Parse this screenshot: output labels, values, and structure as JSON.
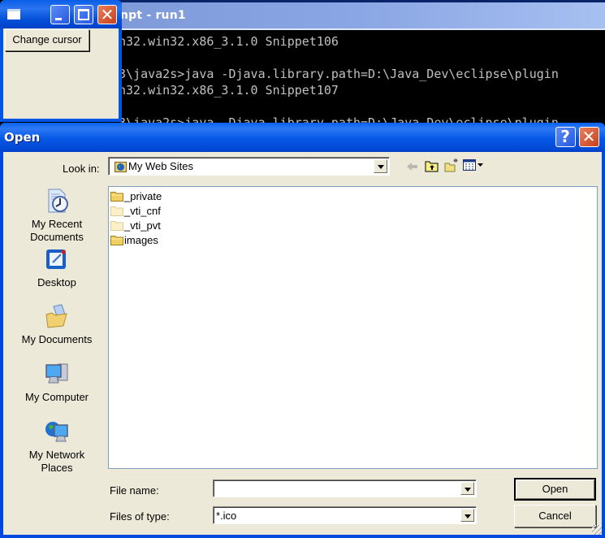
{
  "console": {
    "title": "npt - run1",
    "lines": [
      "n32.win32.x86_3.1.0 Snippet106",
      "",
      "3\\java2s>java -Djava.library.path=D:\\Java_Dev\\eclipse\\plugin",
      "n32.win32.x86_3.1.0 Snippet107",
      "",
      "3\\java2s>java -Djava.library.path=D:\\Java_Dev\\eclipse\\plugin"
    ]
  },
  "small_window": {
    "button_label": "Change cursor",
    "controls": [
      "minimize",
      "maximize",
      "close"
    ]
  },
  "dialog": {
    "title": "Open",
    "title_buttons": {
      "help": "?",
      "close": "✕"
    },
    "look_in": {
      "label": "Look in:",
      "value": "My Web Sites",
      "icon": "web-sites-icon"
    },
    "toolbar": [
      "back",
      "up-one-level",
      "create-new-folder",
      "view-menu"
    ],
    "places": [
      {
        "label_line1": "My Recent",
        "label_line2": "Documents",
        "icon": "recent-documents-icon"
      },
      {
        "label_line1": "Desktop",
        "label_line2": "",
        "icon": "desktop-icon"
      },
      {
        "label_line1": "My Documents",
        "label_line2": "",
        "icon": "my-documents-icon"
      },
      {
        "label_line1": "My Computer",
        "label_line2": "",
        "icon": "my-computer-icon"
      },
      {
        "label_line1": "My Network",
        "label_line2": "Places",
        "icon": "network-places-icon"
      }
    ],
    "files": [
      {
        "name": "_private",
        "hidden": false
      },
      {
        "name": "_vti_cnf",
        "hidden": true
      },
      {
        "name": "_vti_pvt",
        "hidden": true
      },
      {
        "name": "images",
        "hidden": false
      }
    ],
    "file_name": {
      "label": "File name:",
      "value": ""
    },
    "files_of_type": {
      "label": "Files of type:",
      "value": "*.ico"
    },
    "open_label": "Open",
    "cancel_label": "Cancel"
  }
}
